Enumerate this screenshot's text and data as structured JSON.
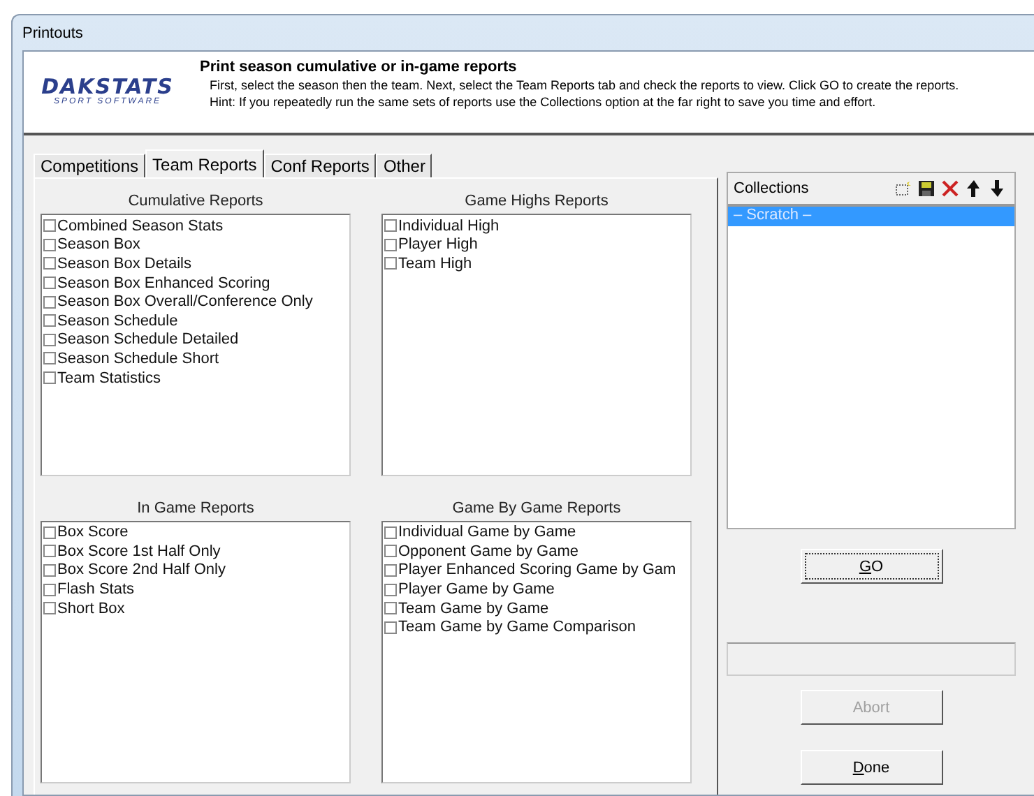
{
  "window": {
    "title": "Printouts"
  },
  "header": {
    "logo_main": "DAKSTATS",
    "logo_sub": "SPORT SOFTWARE",
    "title": "Print season cumulative or in-game reports",
    "lines": [
      "First, select the season then the team.  Next, select the Team Reports tab and check the reports to view. Click GO to create the reports.",
      "Hint: If you repeatedly run the same sets of reports use the Collections option at the far right to save you time and effort."
    ]
  },
  "tabs": [
    {
      "label": "Competitions",
      "selected": false
    },
    {
      "label": "Team Reports",
      "selected": true
    },
    {
      "label": "Conf Reports",
      "selected": false
    },
    {
      "label": "Other",
      "selected": false
    }
  ],
  "groups": [
    {
      "title": "Cumulative Reports",
      "items": [
        {
          "label": "Combined Season Stats",
          "checked": false
        },
        {
          "label": "Season Box",
          "checked": false
        },
        {
          "label": "Season Box Details",
          "checked": false
        },
        {
          "label": "Season Box Enhanced Scoring",
          "checked": false
        },
        {
          "label": "Season Box Overall/Conference Only",
          "checked": false
        },
        {
          "label": "Season Schedule",
          "checked": false
        },
        {
          "label": "Season Schedule Detailed",
          "checked": false
        },
        {
          "label": "Season Schedule Short",
          "checked": false
        },
        {
          "label": "Team Statistics",
          "checked": false
        }
      ]
    },
    {
      "title": "Game Highs Reports",
      "items": [
        {
          "label": "Individual High",
          "checked": false
        },
        {
          "label": "Player High",
          "checked": false
        },
        {
          "label": "Team High",
          "checked": false
        }
      ]
    },
    {
      "title": "In Game Reports",
      "items": [
        {
          "label": "Box Score",
          "checked": false
        },
        {
          "label": "Box Score 1st Half Only",
          "checked": false
        },
        {
          "label": "Box Score 2nd Half Only",
          "checked": false
        },
        {
          "label": "Flash Stats",
          "checked": false
        },
        {
          "label": "Short Box",
          "checked": false
        }
      ]
    },
    {
      "title": "Game By Game Reports",
      "items": [
        {
          "label": "Individual Game by Game",
          "checked": false
        },
        {
          "label": "Opponent Game by Game",
          "checked": false
        },
        {
          "label": "Player Enhanced Scoring Game by Gam",
          "checked": false
        },
        {
          "label": "Player Game by Game",
          "checked": false
        },
        {
          "label": "Team Game by Game",
          "checked": false
        },
        {
          "label": "Team Game by Game Comparison",
          "checked": false
        }
      ]
    }
  ],
  "collections": {
    "title": "Collections",
    "items": [
      {
        "label": "– Scratch –",
        "selected": true
      }
    ]
  },
  "buttons": [
    {
      "label": "GO",
      "disabled": false,
      "underline_first": true,
      "focused": true
    },
    {
      "label": "Abort",
      "disabled": true,
      "underline_first": false,
      "focused": false
    },
    {
      "label": "Done",
      "disabled": false,
      "underline_first": true,
      "focused": false
    }
  ]
}
